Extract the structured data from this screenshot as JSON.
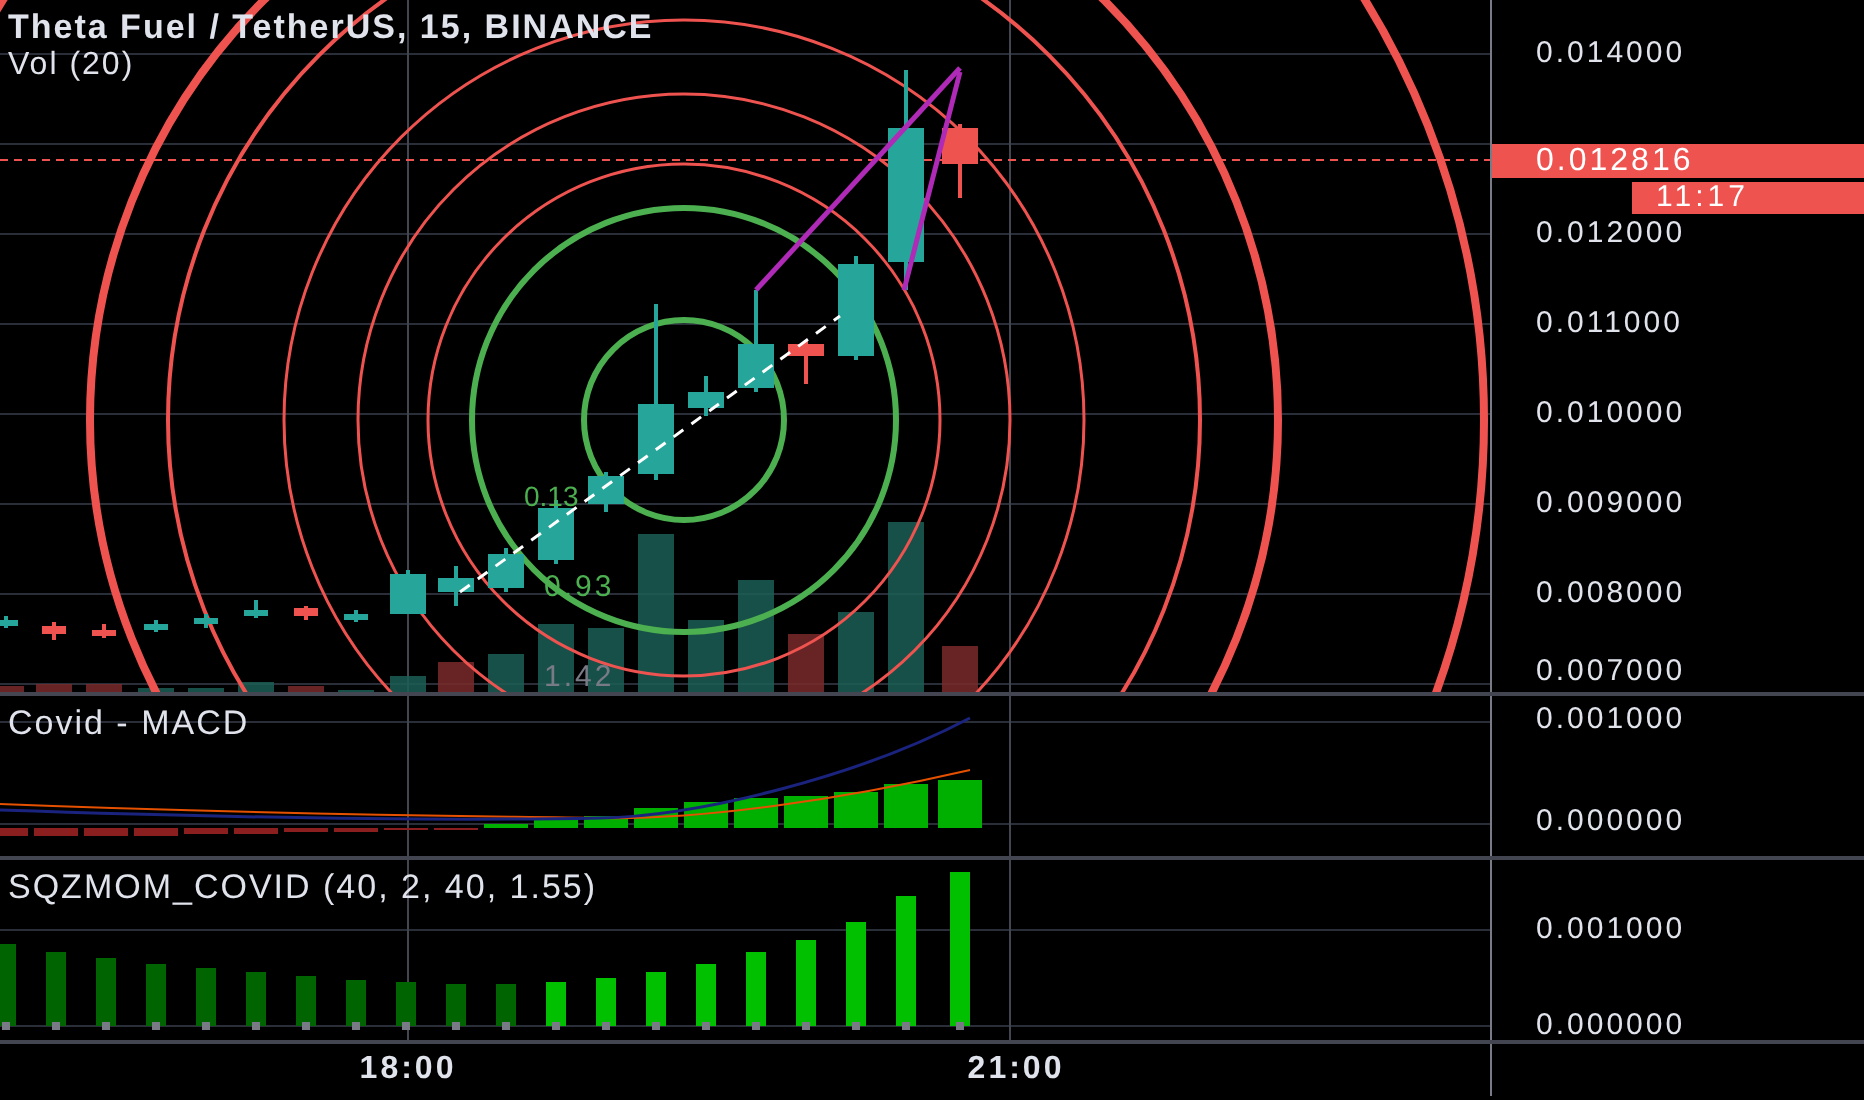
{
  "main_panel": {
    "title": "Theta Fuel / TetherUS, 15, BINANCE",
    "volume_label": "Vol (20)",
    "fib_labels": [
      "0.13",
      "0.93",
      "1.42"
    ],
    "price_axis": [
      "0.014000",
      "0.012000",
      "0.011000",
      "0.010000",
      "0.009000",
      "0.008000",
      "0.007000"
    ],
    "last_price": "0.012816",
    "countdown": "11:17"
  },
  "macd_panel": {
    "title": "Covid - MACD",
    "axis": [
      "0.001000",
      "0.000000"
    ]
  },
  "sqz_panel": {
    "title": "SQZMOM_COVID (40, 2, 40, 1.55)",
    "axis": [
      "0.001000",
      "0.000000"
    ]
  },
  "time_axis": [
    "18:00",
    "21:00"
  ]
}
